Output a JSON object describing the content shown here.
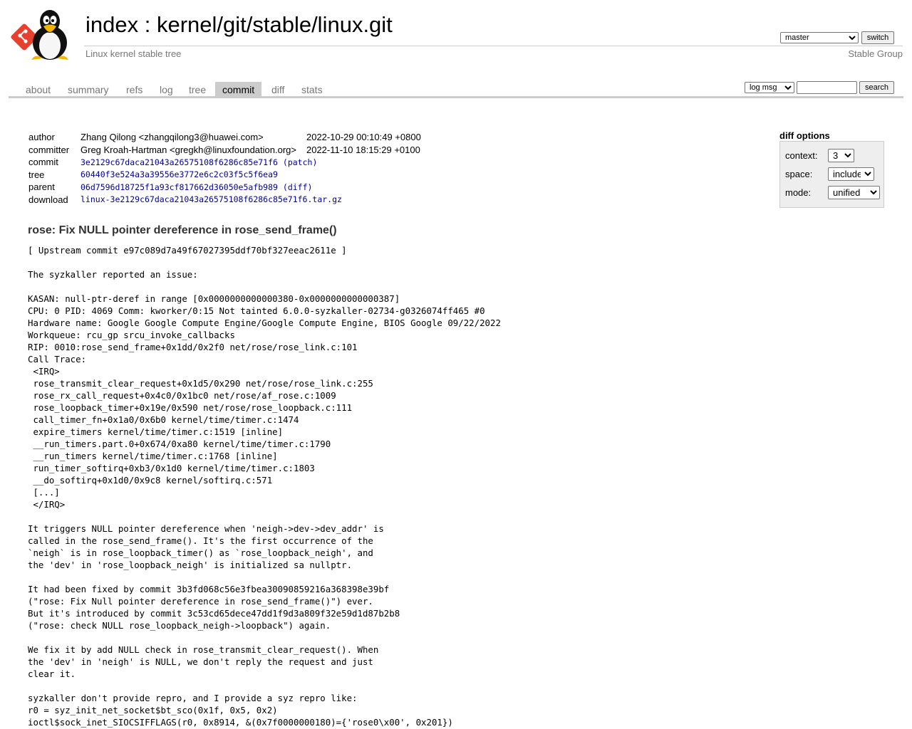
{
  "header": {
    "title_index": "index",
    "title_sep": " : ",
    "title_repo": "kernel/git/stable/linux.git",
    "subtitle": "Linux kernel stable tree",
    "owner": "Stable Group",
    "branch_selected": "master",
    "switch_label": "switch"
  },
  "tabs": [
    {
      "label": "about"
    },
    {
      "label": "summary"
    },
    {
      "label": "refs"
    },
    {
      "label": "log"
    },
    {
      "label": "tree"
    },
    {
      "label": "commit"
    },
    {
      "label": "diff"
    },
    {
      "label": "stats"
    }
  ],
  "search": {
    "type_selected": "log msg",
    "value": "",
    "button_label": "search"
  },
  "commit_info": {
    "author_label": "author",
    "author_name": "Zhang Qilong <zhangqilong3@huawei.com>",
    "author_date": "2022-10-29 00:10:49 +0800",
    "committer_label": "committer",
    "committer_name": "Greg Kroah-Hartman <gregkh@linuxfoundation.org>",
    "committer_date": "2022-11-10 18:15:29 +0100",
    "commit_label": "commit",
    "commit_hash": "3e2129c67daca21043a26575108f6286c85e71f6",
    "commit_extra_link": "patch",
    "tree_label": "tree",
    "tree_hash": "60440f3e524a3a39556e3772e6c2c03f5c5f6ea9",
    "parent_label": "parent",
    "parent_hash": "06d7596d18725f1a93cf817662d36050e5afb989",
    "parent_extra_link": "diff",
    "download_label": "download",
    "download_file": "linux-3e2129c67daca21043a26575108f6286c85e71f6.tar.gz"
  },
  "diff_options": {
    "title": "diff options",
    "context_label": "context:",
    "context_value": "3",
    "space_label": "space:",
    "space_value": "include",
    "mode_label": "mode:",
    "mode_value": "unified"
  },
  "commit_subject": "rose: Fix NULL pointer dereference in rose_send_frame()",
  "commit_message": "[ Upstream commit e97c089d7a49f67027395ddf70bf327eeac2611e ]\n\nThe syzkaller reported an issue:\n\nKASAN: null-ptr-deref in range [0x0000000000000380-0x0000000000000387]\nCPU: 0 PID: 4069 Comm: kworker/0:15 Not tainted 6.0.0-syzkaller-02734-g0326074ff465 #0\nHardware name: Google Google Compute Engine/Google Compute Engine, BIOS Google 09/22/2022\nWorkqueue: rcu_gp srcu_invoke_callbacks\nRIP: 0010:rose_send_frame+0x1dd/0x2f0 net/rose/rose_link.c:101\nCall Trace:\n <IRQ>\n rose_transmit_clear_request+0x1d5/0x290 net/rose/rose_link.c:255\n rose_rx_call_request+0x4c0/0x1bc0 net/rose/af_rose.c:1009\n rose_loopback_timer+0x19e/0x590 net/rose/rose_loopback.c:111\n call_timer_fn+0x1a0/0x6b0 kernel/time/timer.c:1474\n expire_timers kernel/time/timer.c:1519 [inline]\n __run_timers.part.0+0x674/0xa80 kernel/time/timer.c:1790\n __run_timers kernel/time/timer.c:1768 [inline]\n run_timer_softirq+0xb3/0x1d0 kernel/time/timer.c:1803\n __do_softirq+0x1d0/0x9c8 kernel/softirq.c:571\n [...]\n </IRQ>\n\nIt triggers NULL pointer dereference when 'neigh->dev->dev_addr' is\ncalled in the rose_send_frame(). It's the first occurrence of the\n`neigh` is in rose_loopback_timer() as `rose_loopback_neigh', and\nthe 'dev' in 'rose_loopback_neigh' is initialized sa nullptr.\n\nIt had been fixed by commit 3b3fd068c56e3fbea30090859216a368398e39bf\n(\"rose: Fix Null pointer dereference in rose_send_frame()\") ever.\nBut it's introduced by commit 3c53cd65dece47dd1f9d3a809f32e59d1d87b2b8\n(\"rose: check NULL rose_loopback_neigh->loopback\") again.\n\nWe fix it by add NULL check in rose_transmit_clear_request(). When\nthe 'dev' in 'neigh' is NULL, we don't reply the request and just\nclear it.\n\nsyzkaller don't provide repro, and I provide a syz repro like:\nr0 = syz_init_net_socket$bt_sco(0x1f, 0x5, 0x2)\nioctl$sock_inet_SIOCSIFFLAGS(r0, 0x8914, &(0x7f0000000180)={'rose0\\x00', 0x201})"
}
